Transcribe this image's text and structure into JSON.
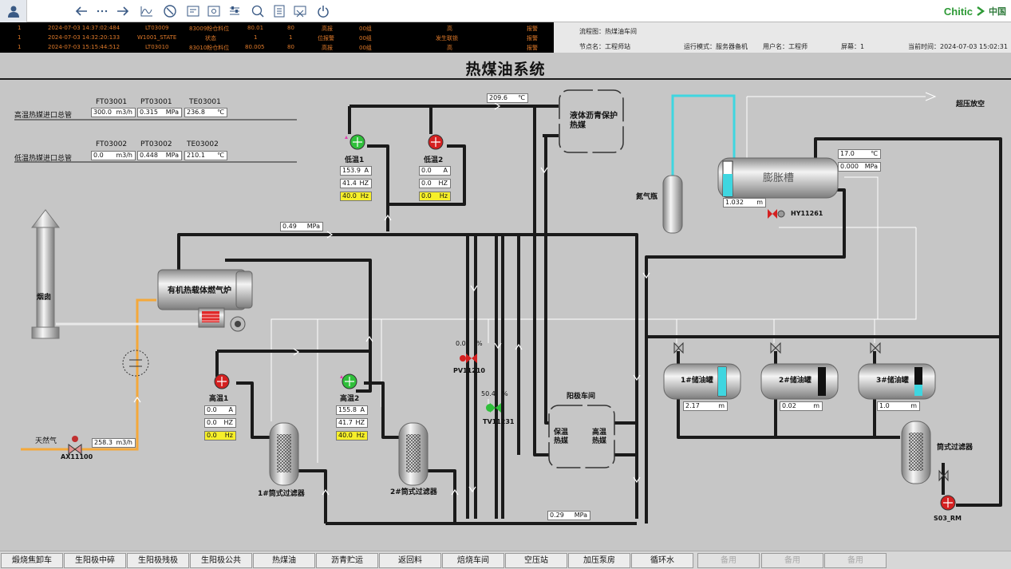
{
  "title": "热煤油系统",
  "alarms": [
    {
      "seq": "1",
      "time": "2024-07-03  14:37:02:484",
      "tag": "LT03009",
      "desc": "83009粉仓料位",
      "value": "80.01",
      "limit": "80",
      "type": "高报",
      "group": "00组",
      "level": "高",
      "state": "报警"
    },
    {
      "seq": "1",
      "time": "2024-07-03  14:32:20:133",
      "tag": "W1001_STATE",
      "desc": "状态",
      "value": "1",
      "limit": "1",
      "type": "位报警",
      "group": "00组",
      "level": "发生联锁",
      "state": "报警"
    },
    {
      "seq": "1",
      "time": "2024-07-03  15:15:44:512",
      "tag": "LT03010",
      "desc": "83010粉仓料位",
      "value": "80.005",
      "limit": "80",
      "type": "高报",
      "group": "00组",
      "level": "高",
      "state": "报警"
    }
  ],
  "info": {
    "flow": "流程图：热煤油车间",
    "node": "节点名：工程师站",
    "mode": "运行模式：服务器备机",
    "user": "用户名：工程师",
    "screen": "屏幕：1",
    "time": "当前时间：2024-07-03 15:02:31"
  },
  "header": {
    "high_pipe": "高温热媒进口总管",
    "low_pipe": "低温热媒进口总管",
    "ft1": "FT03001",
    "pt1": "PT03001",
    "te1": "TE03001",
    "ft2": "FT03002",
    "pt2": "PT03002",
    "te2": "TE03002",
    "v_ft1": "300.0",
    "v_pt1": "0.315",
    "v_te1": "236.8",
    "v_ft2": "0.0",
    "v_pt2": "0.448",
    "v_te2": "210.1",
    "u_flow": "m3/h",
    "u_pres": "MPa",
    "u_temp": "℃"
  },
  "pumps": {
    "low1": {
      "name": "低温1",
      "a": "153.9",
      "hz": "41.4",
      "set": "40.0"
    },
    "low2": {
      "name": "低温2",
      "a": "0.0",
      "hz": "0.0",
      "set": "0.0"
    },
    "high1": {
      "name": "高温1",
      "a": "0.0",
      "hz": "0.0",
      "set": "0.0"
    },
    "high2": {
      "name": "高温2",
      "a": "155.8",
      "hz": "41.7",
      "set": "40.0"
    },
    "u_a": "A",
    "u_hz": "HZ",
    "u_set": "Hz"
  },
  "labels": {
    "chimney": "烟囱",
    "furnace": "有机热载体燃气炉",
    "gas": "天然气",
    "gas_valve": "AX11100",
    "gas_flow": "258.3",
    "liquid_tank": "液体沥青保护热媒",
    "nitrogen": "氮气瓶",
    "expansion": "膨胀槽",
    "exp_level": "1.032",
    "exp_temp": "17.0",
    "exp_pres": "0.000",
    "hy": "HY11261",
    "vent": "超压放空",
    "top_temp": "209.6",
    "p_mid": "0.49",
    "p_bottom": "0.29",
    "pv_pct": "0.0",
    "pv": "PV11210",
    "tv_pct": "50.4",
    "tv": "TV11231",
    "pct": "%",
    "anode": "阳极车间",
    "keep": "保温热媒",
    "hot": "高温热媒",
    "filter1": "1#筒式过滤器",
    "filter2": "2#筒式过滤器",
    "filter3": "筒式过滤器",
    "tank1": "1#储油罐",
    "t1v": "2.17",
    "tank2": "2#储油罐",
    "t2v": "0.02",
    "tank3": "3#储油罐",
    "t3v": "1.0",
    "s03": "S03_RM",
    "m": "m"
  },
  "nav": [
    "煅烧焦卸车",
    "生阳极中碎",
    "生阳极残极",
    "生阳极公共",
    "热煤油",
    "沥青贮运",
    "返回料",
    "焙烧车间",
    "空压站",
    "加压泵房",
    "循环水",
    "备用",
    "备用",
    "备用"
  ],
  "colors": {
    "alarm_text": "#e07a2a",
    "cyan": "#3fd6e0",
    "yellow": "#f6ef2a",
    "pump_green": "#2fbf3a",
    "pump_red": "#d42020",
    "orange_pipe": "#f4a83a"
  }
}
